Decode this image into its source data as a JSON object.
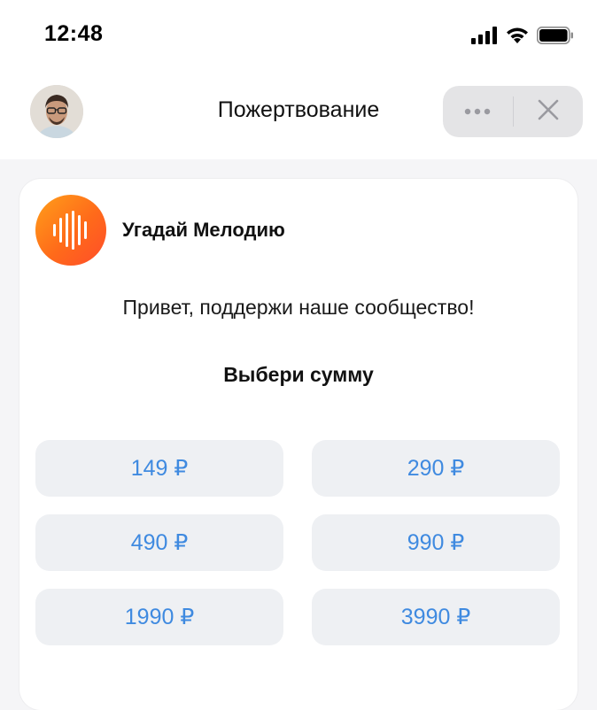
{
  "status_bar": {
    "time": "12:48"
  },
  "nav": {
    "title": "Пожертвование"
  },
  "community": {
    "name": "Угадай Мелодию"
  },
  "greeting": "Привет, поддержи наше сообщество!",
  "choose_amount_label": "Выбери сумму",
  "amounts": [
    {
      "label": "149 ₽"
    },
    {
      "label": "290 ₽"
    },
    {
      "label": "490 ₽"
    },
    {
      "label": "990 ₽"
    },
    {
      "label": "1990 ₽"
    },
    {
      "label": "3990 ₽"
    }
  ],
  "colors": {
    "accent": "#3f8ae0",
    "logo_gradient_start": "#ff9f1a",
    "logo_gradient_end": "#ff4d2a",
    "button_bg": "#eef0f3",
    "page_bg": "#f5f5f7"
  },
  "icons": {
    "signal": "cellular-signal-icon",
    "wifi": "wifi-icon",
    "battery": "battery-icon",
    "more": "more-horizontal-icon",
    "close": "close-icon"
  }
}
